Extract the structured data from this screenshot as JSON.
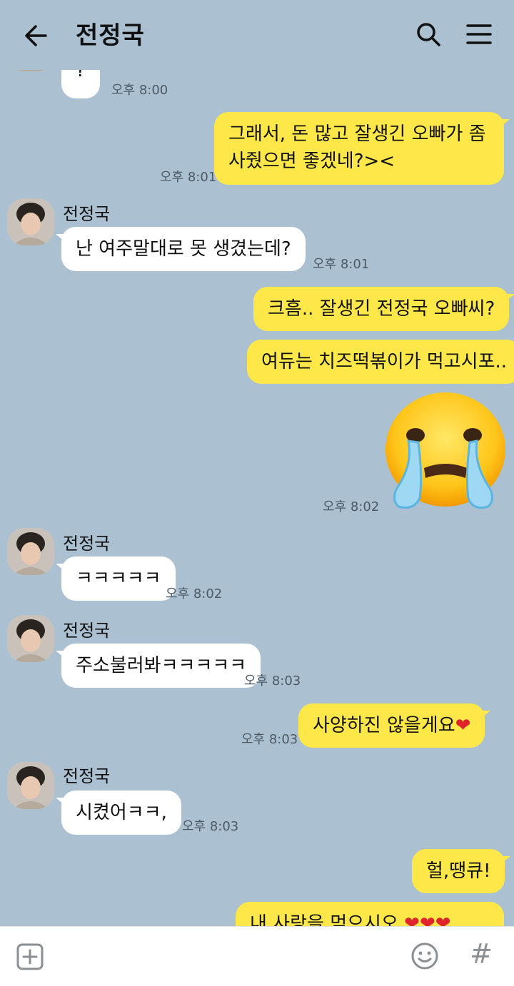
{
  "header": {
    "title": "전정국",
    "back_icon": "arrow-left-icon",
    "search_icon": "search-icon",
    "menu_icon": "hamburger-menu-icon"
  },
  "messages": [
    {
      "text": "?",
      "time": "오후 8:00"
    },
    {
      "line1": "그래서, 돈 많고 잘생긴 오빠가 좀",
      "line2": "사줬으면 좋겠네?><",
      "time": "오후 8:01"
    },
    {
      "sender": "전정국",
      "text": "난 여주말대로 못 생겼는데?",
      "time": "오후 8:01"
    },
    {
      "text": "크흠.. 잘생긴 전정국 오빠씨?"
    },
    {
      "text": "여듀는 치즈떡볶이가 먹고시포.."
    },
    {
      "sticker": "crying-face-emoji",
      "time": "오후 8:02"
    },
    {
      "sender": "전정국",
      "text": "ㅋㅋㅋㅋㅋ",
      "time": "오후 8:02"
    },
    {
      "sender": "전정국",
      "text": "주소불러봐ㅋㅋㅋㅋㅋ",
      "time": "오후 8:03"
    },
    {
      "text": "사양하진 않을게요",
      "heart": "❤",
      "time": "오후 8:03"
    },
    {
      "sender": "전정국",
      "text": "시켰어ㅋㅋ,",
      "time": "오후 8:03"
    },
    {
      "text": "헐,땡큐!"
    },
    {
      "text": "내 사랑을 먹으시오 ",
      "hearts": "❤❤❤"
    }
  ],
  "bottom_bar": {
    "add_icon": "plus-square-icon",
    "emoticon_icon": "smiley-icon",
    "hash_label": "#"
  },
  "colors": {
    "background": "#abc1d1",
    "outgoing_bubble": "#fee849",
    "incoming_bubble": "#ffffff",
    "heart": "#e0242b"
  }
}
